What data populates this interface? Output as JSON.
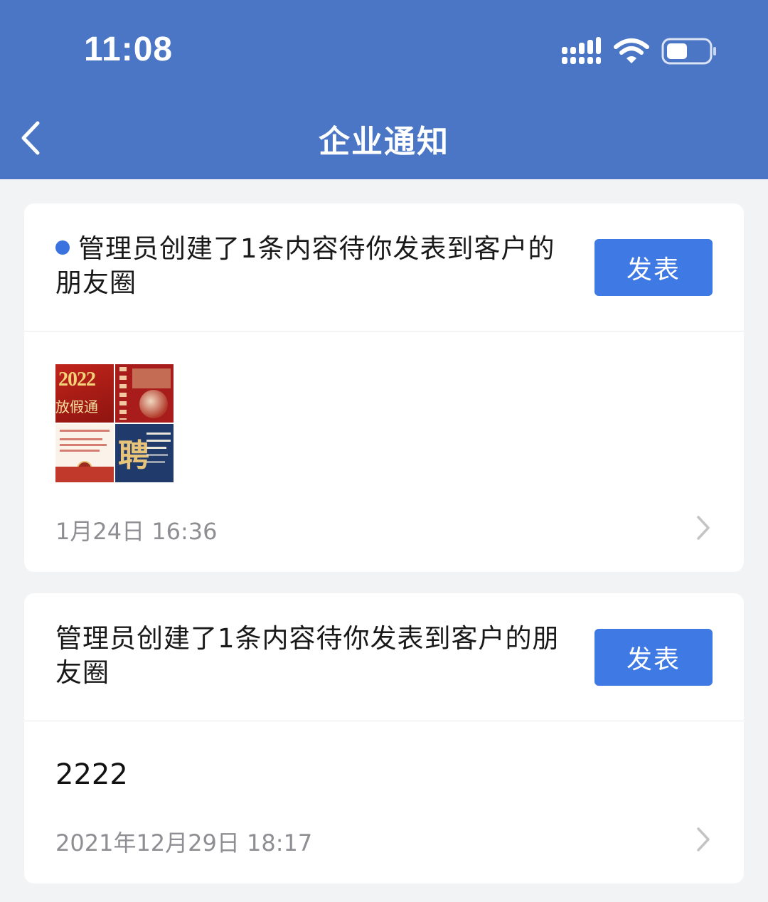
{
  "status_bar": {
    "time": "11:08"
  },
  "header": {
    "title": "企业通知",
    "back_icon": "chevron-left-icon"
  },
  "notifications": [
    {
      "unread": true,
      "title": "管理员创建了1条内容待你发表到客户的朋友圈",
      "button_label": "发表",
      "thumbnail_text": {
        "year": "2022",
        "caption": "放假通"
      },
      "date": "1月24日 16:36"
    },
    {
      "unread": false,
      "title": "管理员创建了1条内容待你发表到客户的朋友圈",
      "button_label": "发表",
      "content": "2222",
      "date": "2021年12月29日 18:17"
    }
  ],
  "colors": {
    "header": "#4a76c5",
    "button": "#3f79e4",
    "unread_dot": "#3a72e0",
    "background": "#f2f3f5"
  }
}
